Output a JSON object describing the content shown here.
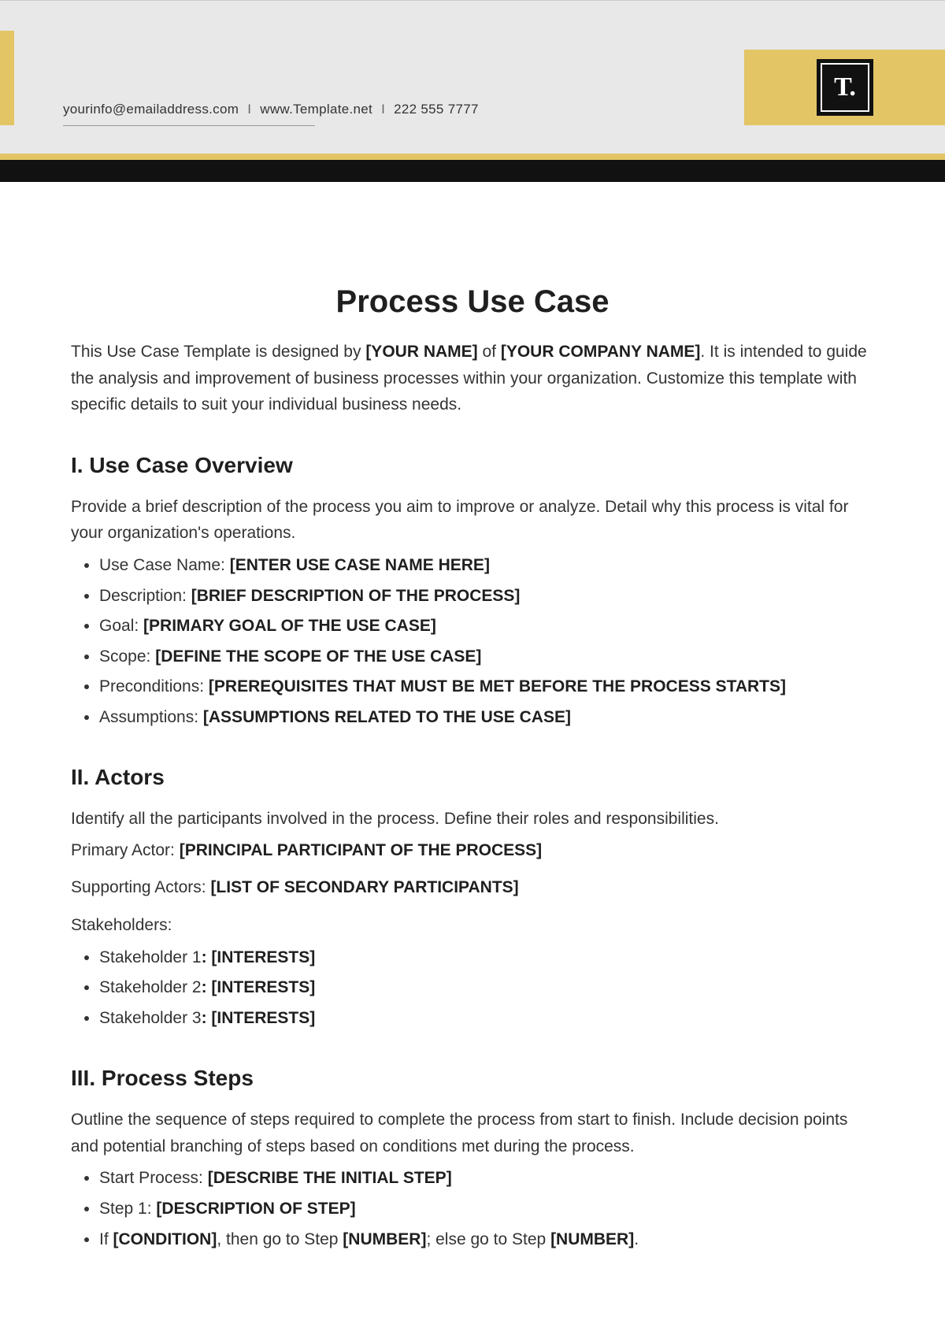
{
  "header": {
    "email": "yourinfo@emailaddress.com",
    "website": "www.Template.net",
    "phone": "222 555 7777",
    "logo_text": "T."
  },
  "title": "Process Use Case",
  "intro": {
    "t1": "This Use Case Template is designed by ",
    "ph1": "[YOUR NAME]",
    "t2": " of ",
    "ph2": "[YOUR COMPANY NAME]",
    "t3": ". It is intended to guide the analysis and improvement of business processes within your organization. Customize this template with specific details to suit your individual business needs."
  },
  "section1": {
    "heading": "I. Use Case Overview",
    "desc": "Provide a brief description of the process you aim to improve or analyze. Detail why this process is vital for your organization's operations.",
    "items": [
      {
        "label": "Use Case Name: ",
        "ph": "[ENTER USE CASE NAME HERE]"
      },
      {
        "label": "Description: ",
        "ph": "[BRIEF DESCRIPTION OF THE PROCESS]"
      },
      {
        "label": "Goal: ",
        "ph": "[PRIMARY GOAL OF THE USE CASE]"
      },
      {
        "label": "Scope: ",
        "ph": "[DEFINE THE SCOPE OF THE USE CASE]"
      },
      {
        "label": "Preconditions: ",
        "ph": "[PREREQUISITES THAT MUST BE MET BEFORE THE PROCESS STARTS]"
      },
      {
        "label": "Assumptions: ",
        "ph": "[ASSUMPTIONS RELATED TO THE USE CASE]"
      }
    ]
  },
  "section2": {
    "heading": "II. Actors",
    "desc": "Identify all the participants involved in the process. Define their roles and responsibilities.",
    "primary_label": "Primary Actor: ",
    "primary_ph": "[PRINCIPAL PARTICIPANT OF THE PROCESS]",
    "supporting_label": "Supporting Actors: ",
    "supporting_ph": "[LIST OF SECONDARY PARTICIPANTS]",
    "stakeholders_label": "Stakeholders:",
    "stakeholders": [
      {
        "label": "Stakeholder 1",
        "colon": ": ",
        "ph": "[INTERESTS]"
      },
      {
        "label": "Stakeholder 2",
        "colon": ": ",
        "ph": "[INTERESTS]"
      },
      {
        "label": "Stakeholder 3",
        "colon": ": ",
        "ph": "[INTERESTS]"
      }
    ]
  },
  "section3": {
    "heading": "III. Process Steps",
    "desc": "Outline the sequence of steps required to complete the process from start to finish. Include decision points and potential branching of steps based on conditions met during the process.",
    "items": [
      {
        "label": "Start Process: ",
        "ph": "[DESCRIBE THE INITIAL STEP]"
      },
      {
        "label": "Step 1: ",
        "ph": "[DESCRIPTION OF STEP]"
      }
    ],
    "cond": {
      "t1": "If ",
      "ph1": "[CONDITION]",
      "t2": ", then go to Step ",
      "ph2": "[NUMBER]",
      "t3": "; else go to Step ",
      "ph3": "[NUMBER]",
      "t4": "."
    }
  }
}
